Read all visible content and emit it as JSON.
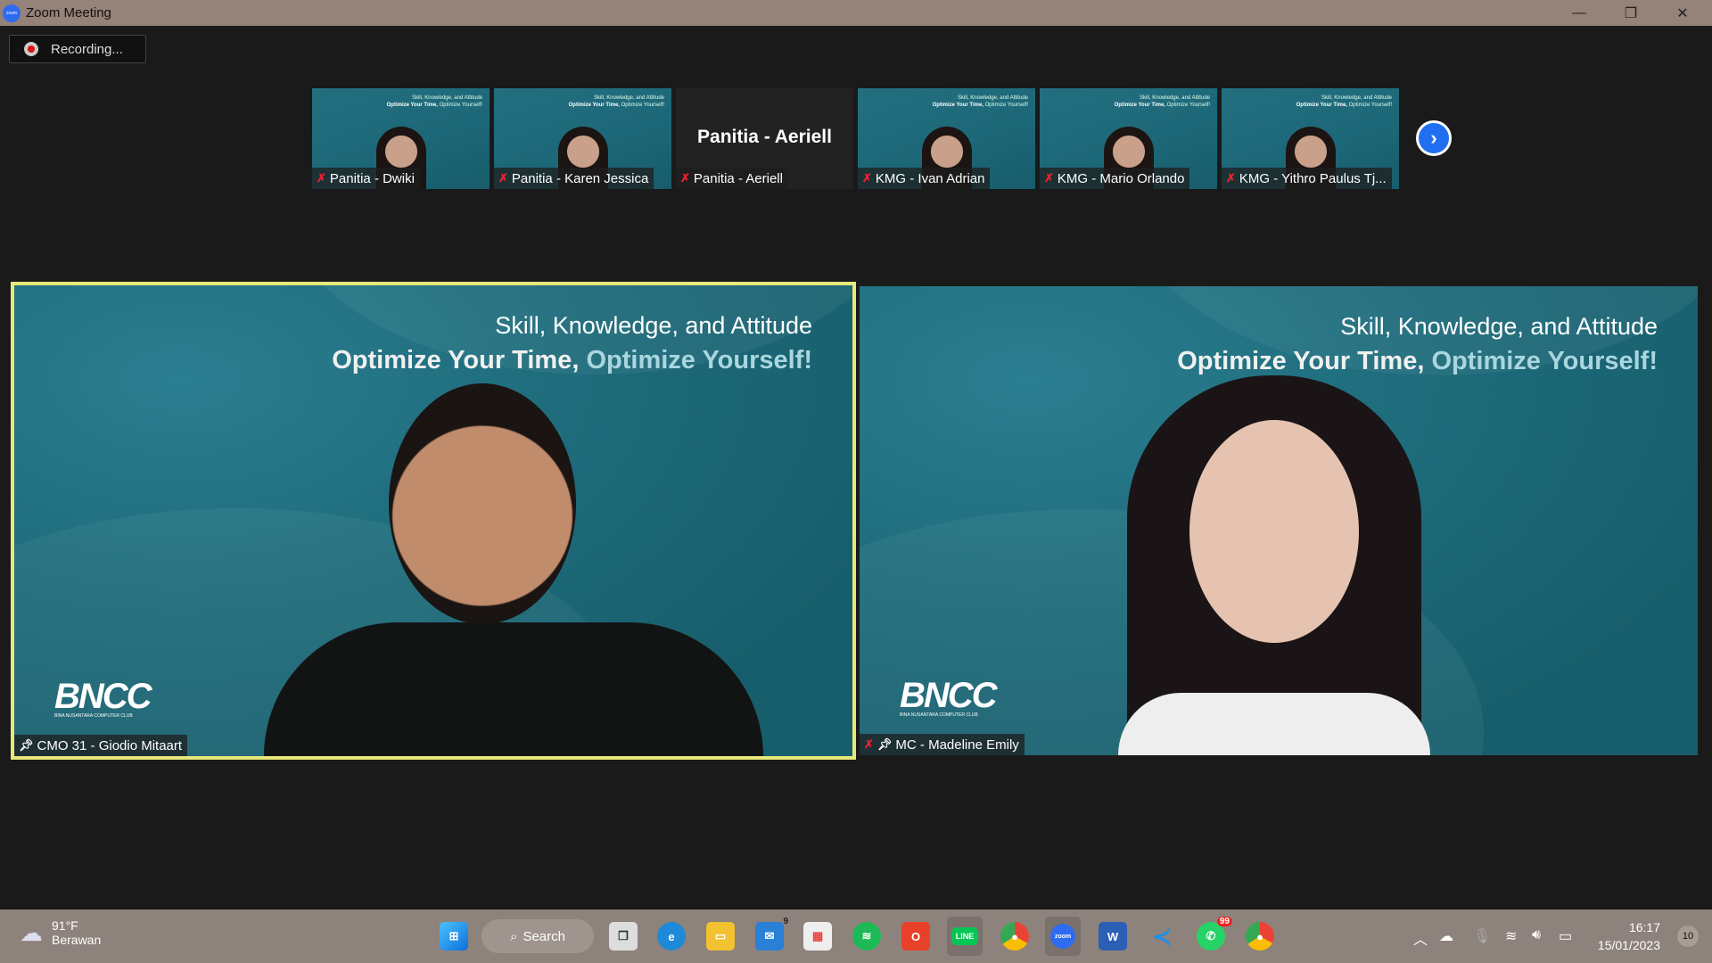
{
  "window": {
    "title": "Zoom Meeting",
    "app_icon": "zoom",
    "min": "—",
    "restore": "❐",
    "close": "✕"
  },
  "recording": {
    "label": "Recording..."
  },
  "slide": {
    "line1": "Skill, Knowledge, and Attitude",
    "line2a": "Optimize Your Time,",
    "line2b": "Optimize Yourself!",
    "logo": "BNCC",
    "logo_sub": "BINA NUSANTARA COMPUTER CLUB"
  },
  "gallery": [
    {
      "name": "Panitia - Dwiki",
      "muted": true,
      "video": true
    },
    {
      "name": "Panitia - Karen Jessica",
      "muted": true,
      "video": true
    },
    {
      "name": "Panitia - Aeriell",
      "muted": true,
      "video": false,
      "display_name": "Panitia - Aeriell"
    },
    {
      "name": "KMG - Ivan Adrian",
      "muted": true,
      "video": true
    },
    {
      "name": "KMG - Mario Orlando",
      "muted": true,
      "video": true
    },
    {
      "name": "KMG - Yithro Paulus Tj...",
      "muted": true,
      "video": true
    }
  ],
  "next_page": "›",
  "speakers": [
    {
      "name": "CMO 31 - Giodio Mitaart",
      "pinned": true,
      "muted": false,
      "active_speaker": true,
      "highlight": "#e8e87a"
    },
    {
      "name": "MC - Madeline Emily",
      "pinned": true,
      "muted": true
    }
  ],
  "taskbar": {
    "weather": {
      "temp": "91°F",
      "desc": "Berawan"
    },
    "search_label": "Search",
    "mail_badge": "9",
    "whatsapp_badge": "99",
    "time": "16:17",
    "date": "15/01/2023",
    "notifications": "10"
  }
}
